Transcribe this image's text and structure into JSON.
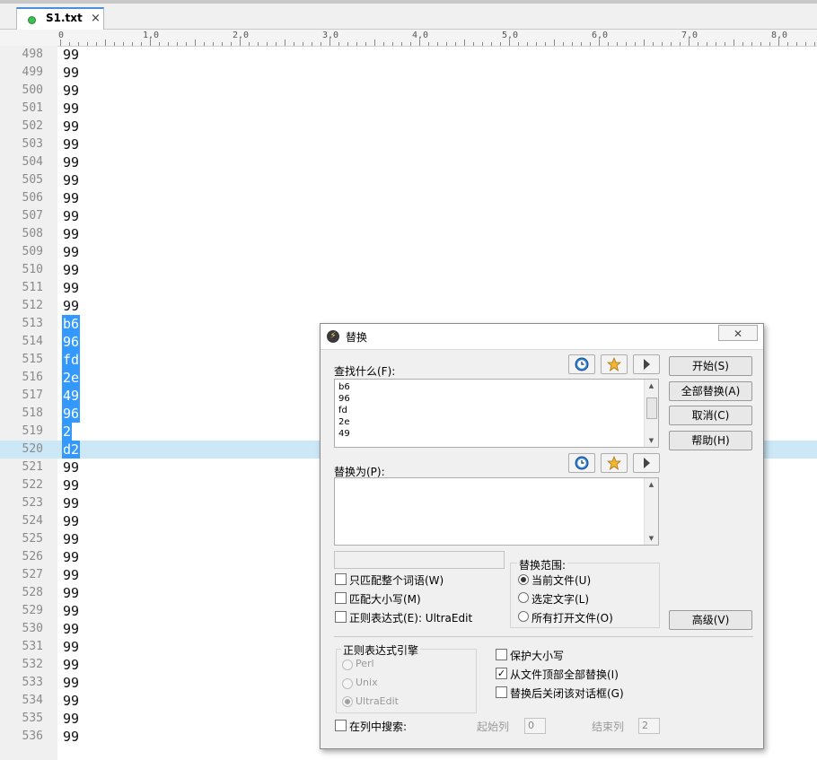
{
  "tab": {
    "filename": "S1.txt",
    "close": "×"
  },
  "ruler": {
    "marks": [
      "0",
      "1,0",
      "2,0",
      "3,0",
      "4,0",
      "5,0",
      "6,0",
      "7,0",
      "8,0"
    ]
  },
  "editor": {
    "current_line": "520",
    "lines": [
      {
        "n": "498",
        "t": "99"
      },
      {
        "n": "499",
        "t": "99"
      },
      {
        "n": "500",
        "t": "99"
      },
      {
        "n": "501",
        "t": "99"
      },
      {
        "n": "502",
        "t": "99"
      },
      {
        "n": "503",
        "t": "99"
      },
      {
        "n": "504",
        "t": "99"
      },
      {
        "n": "505",
        "t": "99"
      },
      {
        "n": "506",
        "t": "99"
      },
      {
        "n": "507",
        "t": "99"
      },
      {
        "n": "508",
        "t": "99"
      },
      {
        "n": "509",
        "t": "99"
      },
      {
        "n": "510",
        "t": "99"
      },
      {
        "n": "511",
        "t": "99"
      },
      {
        "n": "512",
        "t": "99"
      },
      {
        "n": "513",
        "t": "b6",
        "sel": true
      },
      {
        "n": "514",
        "t": "96",
        "sel": true
      },
      {
        "n": "515",
        "t": "fd",
        "sel": true
      },
      {
        "n": "516",
        "t": "2e",
        "sel": true
      },
      {
        "n": "517",
        "t": "49",
        "sel": true
      },
      {
        "n": "518",
        "t": "96",
        "sel": true
      },
      {
        "n": "519",
        "t": "2",
        "sel": true
      },
      {
        "n": "520",
        "t": "d2",
        "sel": true
      },
      {
        "n": "521",
        "t": "99"
      },
      {
        "n": "522",
        "t": "99"
      },
      {
        "n": "523",
        "t": "99"
      },
      {
        "n": "524",
        "t": "99"
      },
      {
        "n": "525",
        "t": "99"
      },
      {
        "n": "526",
        "t": "99"
      },
      {
        "n": "527",
        "t": "99"
      },
      {
        "n": "528",
        "t": "99"
      },
      {
        "n": "529",
        "t": "99"
      },
      {
        "n": "530",
        "t": "99"
      },
      {
        "n": "531",
        "t": "99"
      },
      {
        "n": "532",
        "t": "99"
      },
      {
        "n": "533",
        "t": "99"
      },
      {
        "n": "534",
        "t": "99"
      },
      {
        "n": "535",
        "t": "99"
      },
      {
        "n": "536",
        "t": "99"
      }
    ]
  },
  "dialog": {
    "title": "替换",
    "close": "✕",
    "find_label": "查找什么(F):",
    "find_lines": [
      "b6",
      "96",
      "fd",
      "2e",
      "49"
    ],
    "replace_label": "替换为(P):",
    "buttons": {
      "start": "开始(S)",
      "replace_all": "全部替换(A)",
      "cancel": "取消(C)",
      "help": "帮助(H)",
      "advanced": "高级(V)"
    },
    "options": {
      "whole_word": "只匹配整个词语(W)",
      "match_case": "匹配大小写(M)",
      "regex": "正则表达式(E): UltraEdit"
    },
    "scope": {
      "title": "替换范围:",
      "current_file": "当前文件(U)",
      "selected_text": "选定文字(L)",
      "all_open_files": "所有打开文件(O)"
    },
    "regex_engine": {
      "title": "正则表达式引擎",
      "perl": "Perl",
      "unix": "Unix",
      "ultraedit": "UltraEdit"
    },
    "extra": {
      "preserve_case": "保护大小写",
      "replace_all_from_top": "从文件顶部全部替换(I)",
      "close_after_replace": "替换后关闭该对话框(G)"
    },
    "column": {
      "search_in_column": "在列中搜索:",
      "start_col_label": "起始列",
      "start_col_value": "0",
      "end_col_label": "结束列",
      "end_col_value": "2"
    }
  }
}
